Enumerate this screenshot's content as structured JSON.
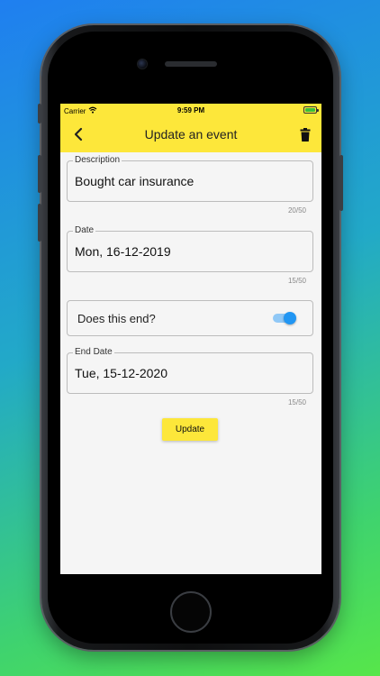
{
  "status_bar": {
    "carrier": "Carrier",
    "time": "9:59 PM"
  },
  "app_bar": {
    "title": "Update an event"
  },
  "fields": {
    "description": {
      "label": "Description",
      "value": "Bought car insurance",
      "counter": "20/50"
    },
    "date": {
      "label": "Date",
      "value": "Mon, 16-12-2019",
      "counter": "15/50"
    },
    "ends": {
      "label": "Does this end?",
      "checked": true
    },
    "end_date": {
      "label": "End Date",
      "value": "Tue, 15-12-2020",
      "counter": "15/50"
    }
  },
  "actions": {
    "update_label": "Update"
  },
  "colors": {
    "accent": "#fde73a",
    "switch": "#2196f3",
    "background": "#f5f5f5"
  },
  "icons": [
    "wifi-icon",
    "battery-icon",
    "back-arrow-icon",
    "trash-icon"
  ]
}
